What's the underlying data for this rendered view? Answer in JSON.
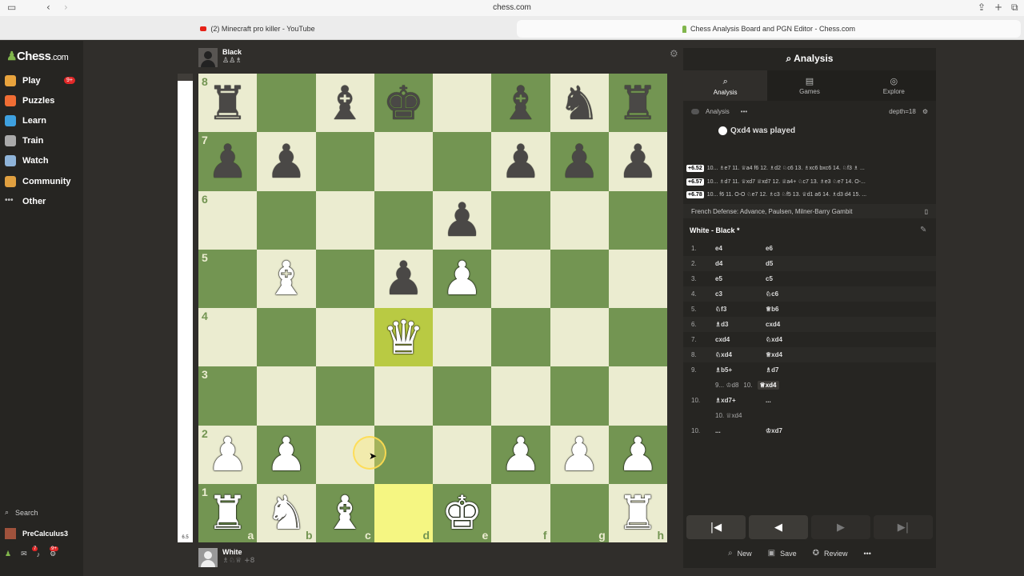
{
  "browser": {
    "url": "chess.com",
    "tab1": "(2) Minecraft pro killer - YouTube",
    "tab2": "Chess Analysis Board and PGN Editor - Chess.com"
  },
  "sidebar": {
    "logo": "Chess",
    "logo_suffix": ".com",
    "play_badge": "9+",
    "items": [
      {
        "label": "Play",
        "color": "#e8a33d"
      },
      {
        "label": "Puzzles",
        "color": "#f06d34"
      },
      {
        "label": "Learn",
        "color": "#3ea1e0"
      },
      {
        "label": "Train",
        "color": "#aaaaaa"
      },
      {
        "label": "Watch",
        "color": "#8fb4d9"
      },
      {
        "label": "Community",
        "color": "#e0a040"
      },
      {
        "label": "Other",
        "color": "#bbbbbb"
      }
    ],
    "search": "Search",
    "username": "PreCalculus3",
    "notif_badge": "7",
    "notif_badge2": "9+"
  },
  "top_player": {
    "name": "Black",
    "captured": "♙♙♗"
  },
  "bottom_player": {
    "name": "White",
    "captured": "♗♘♕",
    "score": "+8"
  },
  "eval_value": "6.5",
  "eval_fraction": 0.985,
  "board": {
    "pieces": [
      {
        "sq": "a8",
        "p": "♜",
        "c": "b"
      },
      {
        "sq": "c8",
        "p": "♝",
        "c": "b"
      },
      {
        "sq": "d8",
        "p": "♚",
        "c": "b"
      },
      {
        "sq": "f8",
        "p": "♝",
        "c": "b"
      },
      {
        "sq": "g8",
        "p": "♞",
        "c": "b"
      },
      {
        "sq": "h8",
        "p": "♜",
        "c": "b"
      },
      {
        "sq": "a7",
        "p": "♟",
        "c": "b"
      },
      {
        "sq": "b7",
        "p": "♟",
        "c": "b"
      },
      {
        "sq": "f7",
        "p": "♟",
        "c": "b"
      },
      {
        "sq": "g7",
        "p": "♟",
        "c": "b"
      },
      {
        "sq": "h7",
        "p": "♟",
        "c": "b"
      },
      {
        "sq": "e6",
        "p": "♟",
        "c": "b"
      },
      {
        "sq": "d5",
        "p": "♟",
        "c": "b"
      },
      {
        "sq": "b5",
        "p": "♝",
        "c": "w"
      },
      {
        "sq": "e5",
        "p": "♟",
        "c": "w"
      },
      {
        "sq": "d4",
        "p": "♛",
        "c": "w"
      },
      {
        "sq": "a2",
        "p": "♟",
        "c": "w"
      },
      {
        "sq": "b2",
        "p": "♟",
        "c": "w"
      },
      {
        "sq": "f2",
        "p": "♟",
        "c": "w"
      },
      {
        "sq": "g2",
        "p": "♟",
        "c": "w"
      },
      {
        "sq": "h2",
        "p": "♟",
        "c": "w"
      },
      {
        "sq": "a1",
        "p": "♜",
        "c": "w"
      },
      {
        "sq": "b1",
        "p": "♞",
        "c": "w"
      },
      {
        "sq": "c1",
        "p": "♝",
        "c": "w"
      },
      {
        "sq": "e1",
        "p": "♚",
        "c": "w"
      },
      {
        "sq": "h1",
        "p": "♜",
        "c": "w"
      }
    ],
    "highlight": [
      "d4",
      "d1"
    ],
    "ranks": [
      "8",
      "7",
      "6",
      "5",
      "4",
      "3",
      "2",
      "1"
    ],
    "files": [
      "a",
      "b",
      "c",
      "d",
      "e",
      "f",
      "g",
      "h"
    ]
  },
  "panel": {
    "title": "Analysis",
    "tabs": [
      {
        "label": "Analysis",
        "icon": "⌕"
      },
      {
        "label": "Games",
        "icon": "▤"
      },
      {
        "label": "Explore",
        "icon": "◎"
      }
    ],
    "analysis_label": "Analysis",
    "more": "•••",
    "depth": "depth=18",
    "played": "Qxd4 was played",
    "engine_lines": [
      {
        "score": "+6.52",
        "text": "10... ♗e7 11. ♕a4 f6 12. ♗d2 ♘c6 13. ♗xc6 bxc6 14. ♘f3 ♗ ..."
      },
      {
        "score": "+6.57",
        "text": "10... ♗d7 11. ♕xd7 ♕xd7 12. ♕a4+ ♘c7 13. ♗e3 ♘e7 14. O-..."
      },
      {
        "score": "+6.78",
        "text": "10... f6 11. O-O ♘e7 12. ♗c3 ♘f5 13. ♕d1 a6 14. ♗d3 d4 15. ..."
      }
    ],
    "opening": "French Defense: Advance, Paulsen, Milner-Barry Gambit",
    "game_title": "White - Black *",
    "moves": [
      {
        "n": "1.",
        "w": "e4",
        "b": "e6"
      },
      {
        "n": "2.",
        "w": "d4",
        "b": "d5"
      },
      {
        "n": "3.",
        "w": "e5",
        "b": "c5"
      },
      {
        "n": "4.",
        "w": "c3",
        "b": "♘c6"
      },
      {
        "n": "5.",
        "w": "♘f3",
        "b": "♕b6"
      },
      {
        "n": "6.",
        "w": "♗d3",
        "b": "cxd4"
      },
      {
        "n": "7.",
        "w": "cxd4",
        "b": "♘xd4"
      },
      {
        "n": "8.",
        "w": "♘xd4",
        "b": "♕xd4"
      },
      {
        "n": "9.",
        "w": "♗b5+",
        "b": "♗d7"
      }
    ],
    "var1_a": "9... ♔d8",
    "var1_b": "10.",
    "var1_sel": "♕xd4",
    "move10": {
      "n": "10.",
      "w": "♗xd7+",
      "b": "..."
    },
    "var2": "10. ♕xd4",
    "move10b": {
      "n": "10.",
      "w": "...",
      "b": "♔xd7"
    },
    "nav": [
      "|◀",
      "◀",
      "▶",
      "▶|"
    ],
    "actions": {
      "new": "New",
      "save": "Save",
      "review": "Review",
      "more": "•••"
    }
  }
}
